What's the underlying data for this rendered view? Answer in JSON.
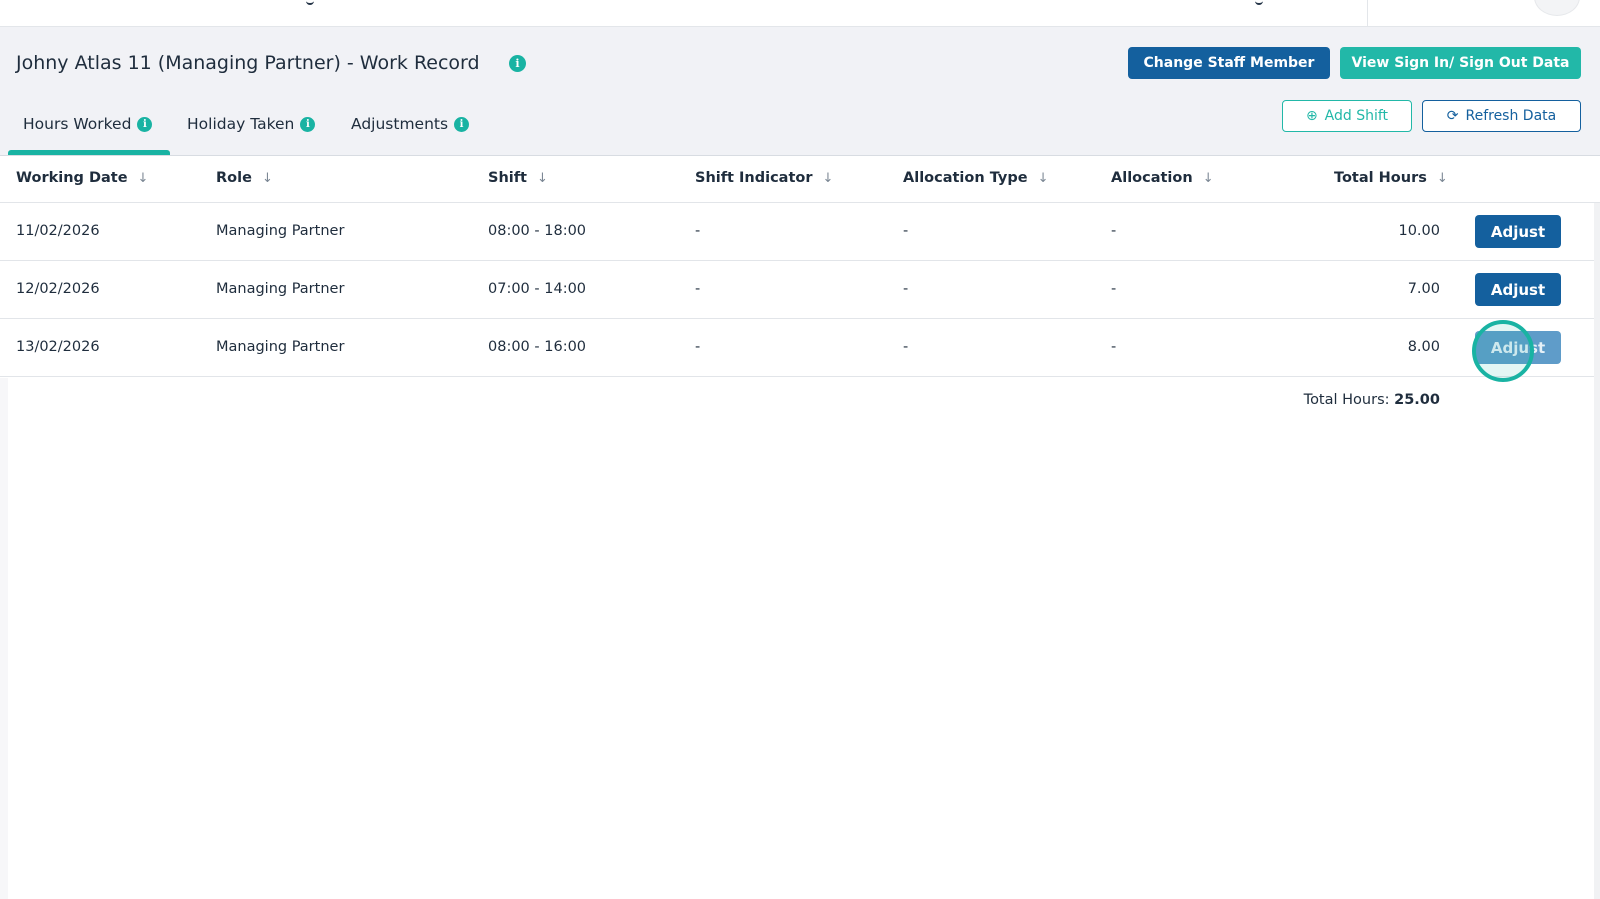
{
  "header": {
    "title": "Johny Atlas 11 (Managing Partner) - Work Record",
    "change_staff_label": "Change Staff Member",
    "view_sign_label": "View Sign In/ Sign Out Data",
    "add_shift_label": "Add Shift",
    "refresh_label": "Refresh Data"
  },
  "tabs": [
    {
      "label": "Hours Worked",
      "active": true
    },
    {
      "label": "Holiday Taken",
      "active": false
    },
    {
      "label": "Adjustments",
      "active": false
    }
  ],
  "table": {
    "columns": [
      "Working Date",
      "Role",
      "Shift",
      "Shift Indicator",
      "Allocation Type",
      "Allocation",
      "Total Hours"
    ],
    "rows": [
      {
        "date": "11/02/2026",
        "role": "Managing Partner",
        "shift": "08:00 - 18:00",
        "indicator": "-",
        "allocation_type": "-",
        "allocation": "-",
        "hours": "10.00",
        "action": "Adjust"
      },
      {
        "date": "12/02/2026",
        "role": "Managing Partner",
        "shift": "07:00 - 14:00",
        "indicator": "-",
        "allocation_type": "-",
        "allocation": "-",
        "hours": "7.00",
        "action": "Adjust"
      },
      {
        "date": "13/02/2026",
        "role": "Managing Partner",
        "shift": "08:00 - 16:00",
        "indicator": "-",
        "allocation_type": "-",
        "allocation": "-",
        "hours": "8.00",
        "action": "Adjust"
      }
    ],
    "total_label": "Total Hours:",
    "total_value": "25.00"
  },
  "icons": {
    "info": "info-icon",
    "sort": "sort-arrow-icon",
    "add": "plus-circle-icon",
    "refresh": "refresh-icon"
  },
  "colors": {
    "primary": "#14609e",
    "accent": "#22b8a8",
    "header_bg": "#f1f2f6"
  }
}
